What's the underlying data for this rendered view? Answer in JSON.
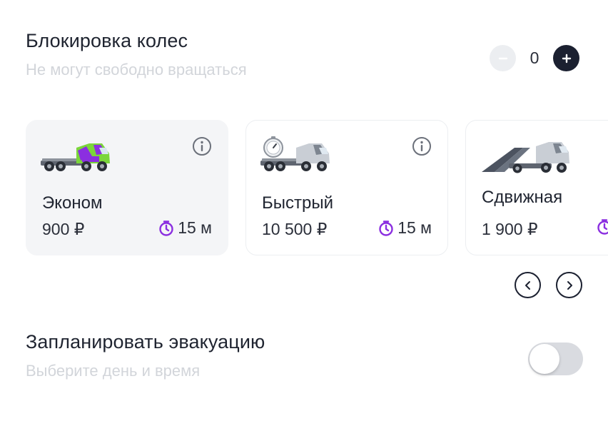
{
  "wheel_lock": {
    "title": "Блокировка колес",
    "subtitle": "Не могут свободно вращаться",
    "count": "0"
  },
  "tariffs": [
    {
      "name": "Эконом",
      "price": "900 ₽",
      "time": "15 м",
      "selected": true,
      "image": "tow-truck-purple-icon"
    },
    {
      "name": "Быстрый",
      "price": "10 500 ₽",
      "time": "15 м",
      "selected": false,
      "image": "tow-truck-stopwatch-icon"
    },
    {
      "name": "Сдвижная",
      "price": "1 900 ₽",
      "time": "",
      "selected": false,
      "image": "tow-truck-sliding-platform-icon"
    }
  ],
  "schedule": {
    "title": "Запланировать эвакуацию",
    "subtitle": "Выберите день и время",
    "enabled": false
  },
  "colors": {
    "accent_purple": "#8b2fe0",
    "dark": "#1b2030",
    "muted_text": "#d2d5da",
    "selected_card_bg": "#f4f5f7"
  }
}
